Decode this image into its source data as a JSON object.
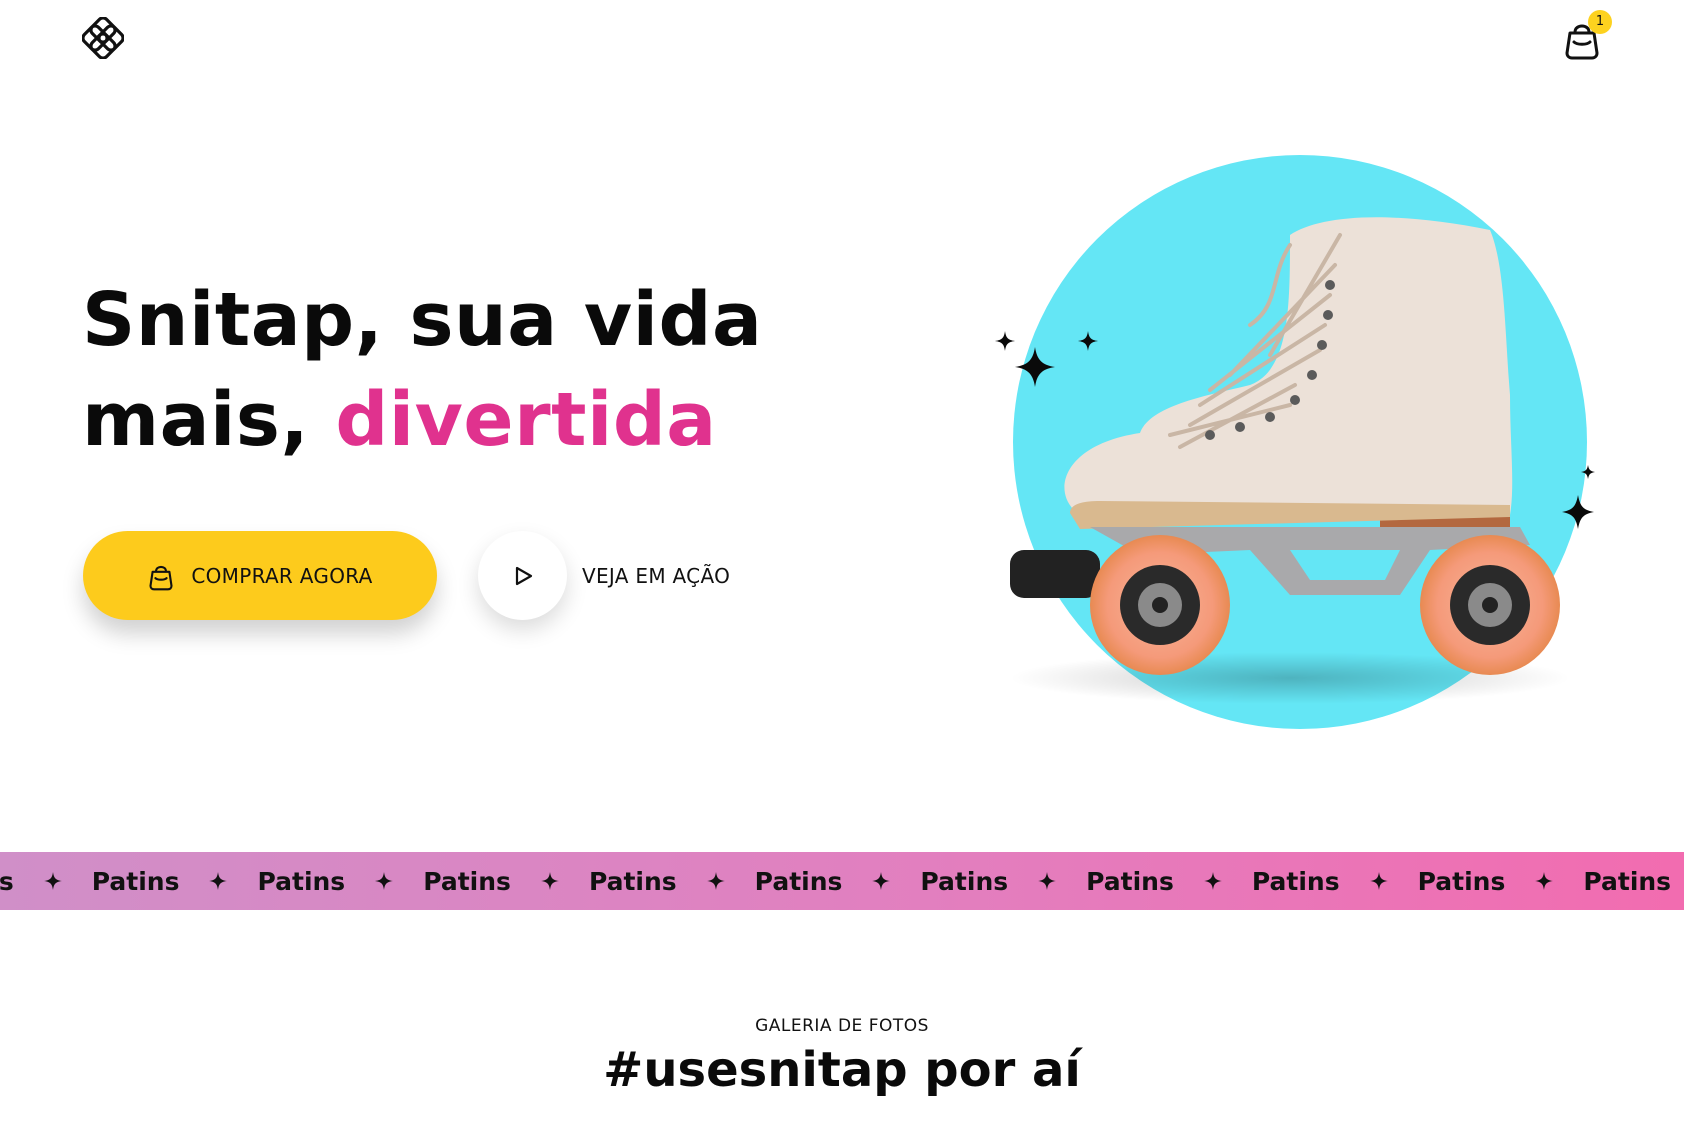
{
  "header": {
    "logo_icon": "snitap-logo-icon",
    "cart_icon": "shopping-bag-icon",
    "cart_count": "1"
  },
  "hero": {
    "title_line1": "Snitap, sua vida",
    "title_line2_prefix": "mais, ",
    "title_line2_accent": "divertida",
    "accent_color": "#e0328e",
    "buy_button": {
      "label": "COMPRAR AGORA",
      "icon": "shopping-bag-icon",
      "color": "#fdcb1c"
    },
    "play_button": {
      "icon": "play-icon"
    },
    "see_action_label": "VEJA EM AÇÃO",
    "image": {
      "subject": "roller-skate",
      "circle_color": "#64e6f5",
      "decorations": "sparkle-icon"
    }
  },
  "marquee": {
    "items": [
      "Patins",
      "Patins",
      "Patins",
      "Patins",
      "Patins",
      "Patins",
      "Patins",
      "Patins",
      "Patins",
      "Patins",
      "Patins"
    ],
    "separator_icon": "sparkle-icon",
    "gradient": [
      "#d08fc8",
      "#f26cb0"
    ]
  },
  "gallery": {
    "eyebrow": "GALERIA DE FOTOS",
    "title": "#usesnitap por aí"
  }
}
